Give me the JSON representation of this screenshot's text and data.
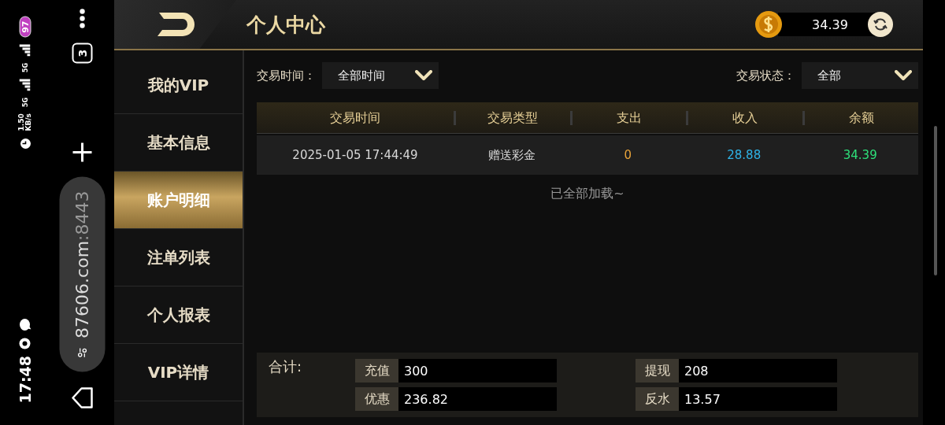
{
  "status_bar": {
    "time": "17:48",
    "speed_value": "1.50",
    "speed_unit": "KB/s",
    "network_labels": [
      "5G",
      "5G"
    ],
    "battery": "97"
  },
  "browser_bar": {
    "url_host": "87606.com",
    "url_port": ":8443",
    "tab_count": "3"
  },
  "header": {
    "title": "个人中心",
    "balance": "34.39"
  },
  "sidebar": {
    "items": [
      {
        "label": "我的VIP",
        "selected": false
      },
      {
        "label": "基本信息",
        "selected": false
      },
      {
        "label": "账户明细",
        "selected": true
      },
      {
        "label": "注单列表",
        "selected": false
      },
      {
        "label": "个人报表",
        "selected": false
      },
      {
        "label": "VIP详情",
        "selected": false
      }
    ]
  },
  "filters": [
    {
      "label": "交易时间：",
      "value": "全部时间"
    },
    {
      "label": "交易状态：",
      "value": "全部"
    }
  ],
  "table": {
    "columns": [
      "交易时间",
      "交易类型",
      "支出",
      "收入",
      "余额"
    ],
    "rows": [
      {
        "cells": [
          {
            "text": "2025-01-05 17:44:49"
          },
          {
            "text": "赠送彩金"
          },
          {
            "text": "0",
            "color": "#e8a33a"
          },
          {
            "text": "28.88",
            "color": "#2fb4e8"
          },
          {
            "text": "34.39",
            "color": "#2ee07a"
          }
        ]
      }
    ]
  },
  "end_note": "已全部加载~",
  "totals": {
    "label": "合计:",
    "items": [
      {
        "label": "充值",
        "value": "300"
      },
      {
        "label": "提现",
        "value": "208"
      },
      {
        "label": "优惠",
        "value": "236.82"
      },
      {
        "label": "反水",
        "value": "13.57"
      }
    ]
  }
}
